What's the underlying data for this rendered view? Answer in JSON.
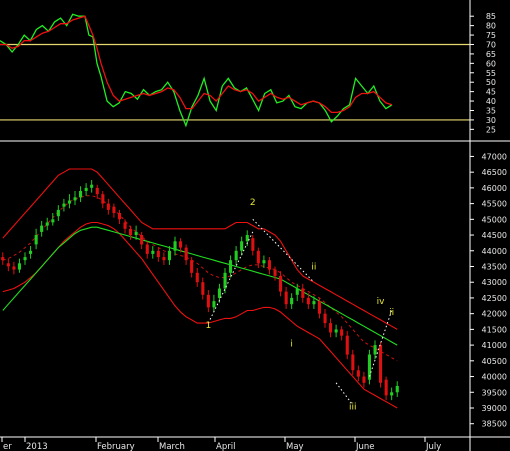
{
  "colors": {
    "background": "#000000",
    "frame": "#ffffff",
    "rsi_line": "#22ee22",
    "rsi_signal": "#ee1111",
    "rsi_level": "#e8d870",
    "candle_up": "#22cc22",
    "candle_down": "#dd1111",
    "band": "#ee1111",
    "band_mid": "#cc1111",
    "moving_average": "#22dd22",
    "wave_projection": "#ffffff",
    "wave_label": "#e6e633",
    "text": "#e8e8e8"
  },
  "chart_data": [
    {
      "type": "line",
      "panel": "oscillator",
      "ylim": [
        22,
        92
      ],
      "y_ticks": [
        25,
        30,
        35,
        40,
        45,
        50,
        55,
        60,
        65,
        70,
        75,
        80,
        85
      ],
      "reference_levels": [
        70,
        30
      ],
      "x": [
        0,
        6,
        12,
        18,
        24,
        30,
        36,
        42,
        48,
        54,
        60,
        66,
        72,
        78,
        84,
        88,
        92,
        96,
        100,
        106,
        112,
        118,
        124,
        130,
        136,
        142,
        148,
        154,
        160,
        166,
        172,
        178,
        184,
        190,
        196,
        202,
        208,
        214,
        220,
        226,
        232,
        238,
        244,
        250,
        256,
        262,
        268,
        274,
        280,
        286,
        292,
        298,
        304,
        310,
        316,
        322,
        328,
        334,
        340,
        346,
        352,
        358,
        364,
        370,
        376,
        382,
        388
      ],
      "series": [
        {
          "values": [
            72,
            70,
            66,
            70,
            75,
            72,
            78,
            80,
            77,
            82,
            84,
            80,
            86,
            85,
            85,
            75,
            74,
            60,
            53,
            40,
            37,
            39,
            45,
            44,
            41,
            46,
            43,
            45,
            46,
            50,
            45,
            35,
            27,
            37,
            43,
            52,
            40,
            35,
            48,
            52,
            47,
            45,
            47,
            41,
            35,
            44,
            46,
            39,
            40,
            43,
            37,
            36,
            39,
            40,
            39,
            35,
            29,
            32,
            36,
            38,
            52,
            48,
            44,
            48,
            40,
            36,
            38
          ]
        },
        {
          "values": [
            70,
            70,
            68,
            69,
            72,
            72,
            74,
            76,
            77,
            79,
            81,
            81,
            83,
            84,
            85,
            80,
            75,
            68,
            60,
            50,
            43,
            40,
            41,
            42,
            43,
            44,
            43,
            44,
            45,
            47,
            46,
            42,
            36,
            36,
            40,
            44,
            43,
            40,
            44,
            48,
            46,
            45,
            46,
            44,
            40,
            42,
            44,
            42,
            41,
            42,
            40,
            38,
            39,
            40,
            39,
            37,
            34,
            34,
            35,
            37,
            42,
            44,
            44,
            45,
            42,
            39,
            38
          ]
        }
      ]
    },
    {
      "type": "candlestick",
      "panel": "price",
      "ylim": [
        38300,
        47300
      ],
      "y_ticks": [
        38500,
        39000,
        39500,
        40000,
        40500,
        41000,
        41500,
        42000,
        42500,
        43000,
        43500,
        44000,
        44500,
        45000,
        45500,
        46000,
        46500,
        47000
      ],
      "x_tick_labels": [
        "er",
        "2013",
        "February",
        "March",
        "April",
        "May",
        "June",
        "July"
      ],
      "x_tick_positions": [
        2,
        25,
        96,
        158,
        215,
        285,
        355,
        425
      ],
      "x_plot_range": [
        0,
        465
      ],
      "close": [
        43700,
        43500,
        43400,
        43600,
        43800,
        44000,
        44500,
        44800,
        44900,
        45000,
        45300,
        45500,
        45600,
        45700,
        45900,
        46000,
        46100,
        45800,
        45500,
        45300,
        45200,
        45000,
        44700,
        44500,
        44600,
        44200,
        43900,
        44000,
        43800,
        43700,
        44000,
        44300,
        44100,
        43700,
        43300,
        43000,
        42600,
        42200,
        42400,
        42800,
        43300,
        43700,
        44000,
        44300,
        44500,
        44000,
        43600,
        43700,
        43400,
        43200,
        42700,
        42300,
        42500,
        42800,
        42500,
        42300,
        42400,
        42000,
        41700,
        41400,
        41500,
        41300,
        40700,
        40200,
        40000,
        39800,
        40700,
        41000,
        39800,
        39400,
        39500,
        39700
      ],
      "open": [
        43800,
        43600,
        43500,
        43400,
        43700,
        43900,
        44200,
        44600,
        44800,
        44900,
        45100,
        45400,
        45500,
        45600,
        45700,
        45900,
        46000,
        46000,
        45800,
        45500,
        45400,
        45200,
        44900,
        44700,
        44500,
        44500,
        44200,
        43900,
        44000,
        43800,
        43700,
        44000,
        44300,
        44100,
        43700,
        43300,
        43000,
        42600,
        42200,
        42500,
        42800,
        43300,
        43700,
        44000,
        44300,
        44400,
        44000,
        43600,
        43700,
        43400,
        43200,
        42700,
        42300,
        42600,
        42800,
        42500,
        42300,
        42400,
        42000,
        41700,
        41400,
        41500,
        41300,
        40700,
        40200,
        40000,
        39900,
        40700,
        41000,
        39900,
        39400,
        39500
      ],
      "high": [
        43950,
        43750,
        43650,
        43750,
        43950,
        44150,
        44700,
        44950,
        45050,
        45200,
        45450,
        45650,
        45800,
        45900,
        46050,
        46150,
        46250,
        46100,
        45900,
        45650,
        45500,
        45300,
        45000,
        44800,
        44800,
        44600,
        44300,
        44150,
        44100,
        43950,
        44150,
        44450,
        44400,
        44200,
        43800,
        43450,
        43150,
        42750,
        42600,
        42950,
        43450,
        43850,
        44150,
        44450,
        44650,
        44500,
        44100,
        43850,
        43800,
        43500,
        43350,
        42850,
        42650,
        42950,
        42950,
        42650,
        42550,
        42500,
        42150,
        41850,
        41650,
        41600,
        41450,
        40850,
        40350,
        40150,
        40850,
        41150,
        41100,
        40000,
        39650,
        39850
      ],
      "low": [
        43550,
        43350,
        43250,
        43300,
        43550,
        43750,
        44050,
        44450,
        44650,
        44800,
        44950,
        45250,
        45350,
        45450,
        45550,
        45750,
        45850,
        45650,
        45350,
        45150,
        45050,
        44850,
        44550,
        44350,
        44350,
        44050,
        43750,
        43750,
        43650,
        43550,
        43550,
        43850,
        43950,
        43550,
        43150,
        42850,
        42450,
        42050,
        42050,
        42350,
        42650,
        43150,
        43550,
        43850,
        44150,
        43850,
        43450,
        43450,
        43250,
        43050,
        42550,
        42150,
        42150,
        42400,
        42350,
        42150,
        42150,
        41850,
        41550,
        41250,
        41250,
        41150,
        40550,
        40050,
        39850,
        39650,
        39750,
        40550,
        39650,
        39250,
        39250,
        39350
      ],
      "band_upper": [
        44400,
        44600,
        44800,
        45000,
        45200,
        45400,
        45600,
        45800,
        46000,
        46200,
        46400,
        46500,
        46600,
        46600,
        46600,
        46600,
        46600,
        46500,
        46300,
        46100,
        45900,
        45700,
        45500,
        45300,
        45100,
        44900,
        44800,
        44700,
        44700,
        44700,
        44700,
        44700,
        44700,
        44700,
        44700,
        44700,
        44700,
        44700,
        44700,
        44700,
        44700,
        44800,
        44900,
        44900,
        44900,
        44800,
        44700,
        44700,
        44600,
        44500,
        44300,
        44000,
        43700,
        43400,
        43200,
        43100,
        43000,
        42900,
        42800,
        42700,
        42600,
        42500,
        42400,
        42300,
        42200,
        42100,
        42000,
        41900,
        41800,
        41700,
        41600,
        41500
      ],
      "band_mid": [
        43700,
        43750,
        43850,
        43950,
        44100,
        44250,
        44450,
        44650,
        44850,
        45050,
        45250,
        45400,
        45550,
        45650,
        45700,
        45750,
        45750,
        45700,
        45600,
        45450,
        45300,
        45150,
        44950,
        44750,
        44600,
        44450,
        44300,
        44200,
        44100,
        44000,
        43950,
        43900,
        43850,
        43800,
        43700,
        43600,
        43450,
        43300,
        43200,
        43150,
        43150,
        43200,
        43300,
        43400,
        43500,
        43550,
        43550,
        43500,
        43450,
        43400,
        43300,
        43150,
        43000,
        42900,
        42800,
        42700,
        42600,
        42500,
        42350,
        42200,
        42050,
        41900,
        41700,
        41500,
        41300,
        41100,
        41000,
        40900,
        40800,
        40700,
        40600,
        40500
      ],
      "band_lower": [
        42700,
        42750,
        42800,
        42900,
        43000,
        43150,
        43300,
        43500,
        43700,
        43900,
        44100,
        44300,
        44450,
        44600,
        44750,
        44850,
        44900,
        44900,
        44850,
        44800,
        44700,
        44550,
        44350,
        44150,
        43950,
        43750,
        43500,
        43250,
        43000,
        42750,
        42500,
        42250,
        42050,
        41900,
        41800,
        41700,
        41700,
        41700,
        41750,
        41800,
        41850,
        41850,
        41900,
        42000,
        42100,
        42100,
        42150,
        42200,
        42200,
        42150,
        42050,
        41900,
        41750,
        41600,
        41500,
        41400,
        41300,
        41200,
        41000,
        40800,
        40600,
        40400,
        40200,
        40000,
        39800,
        39600,
        39500,
        39400,
        39300,
        39200,
        39100,
        39000
      ],
      "moving_average": [
        42100,
        42300,
        42500,
        42700,
        42900,
        43100,
        43300,
        43500,
        43700,
        43900,
        44100,
        44250,
        44400,
        44550,
        44650,
        44700,
        44750,
        44750,
        44700,
        44650,
        44600,
        44550,
        44500,
        44450,
        44400,
        44350,
        44300,
        44250,
        44200,
        44150,
        44100,
        44050,
        44000,
        43950,
        43900,
        43850,
        43800,
        43750,
        43700,
        43650,
        43600,
        43550,
        43500,
        43450,
        43400,
        43350,
        43300,
        43250,
        43200,
        43150,
        43100,
        43000,
        42900,
        42800,
        42700,
        42600,
        42500,
        42400,
        42300,
        42200,
        42100,
        42000,
        41900,
        41800,
        41700,
        41600,
        41500,
        41400,
        41300,
        41200,
        41100,
        41000
      ],
      "wave_labels": [
        {
          "text": "1",
          "value": 41550,
          "bar": 37
        },
        {
          "text": "2",
          "value": 45450,
          "bar": 45
        },
        {
          "text": "i",
          "value": 40950,
          "bar": 52
        },
        {
          "text": "ii",
          "value": 43400,
          "bar": 56
        },
        {
          "text": "iii",
          "value": 38950,
          "bar": 63
        },
        {
          "text": "iv",
          "value": 42300,
          "bar": 68
        },
        {
          "text": "ii",
          "value": 41950,
          "bar": 70
        }
      ]
    }
  ]
}
